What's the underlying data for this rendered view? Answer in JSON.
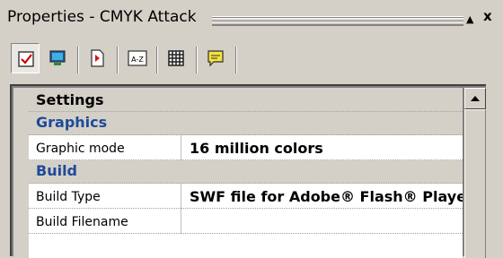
{
  "window": {
    "title": "Properties - CMYK Attack",
    "pin_glyph": "▲",
    "close_glyph": "x"
  },
  "toolbar": {
    "buttons": [
      {
        "name": "properties-icon",
        "active": true
      },
      {
        "name": "display-icon",
        "active": false
      },
      {
        "name": "events-icon",
        "active": false
      },
      {
        "name": "alphabetical-icon",
        "active": false
      },
      {
        "name": "categorized-icon",
        "active": false
      },
      {
        "name": "description-icon",
        "active": false
      }
    ]
  },
  "grid": {
    "section_header": "Settings",
    "categories": {
      "graphics": "Graphics",
      "build": "Build"
    },
    "rows": {
      "graphic_mode": {
        "name": "Graphic mode",
        "value": "16 million colors"
      },
      "build_type": {
        "name": "Build Type",
        "value": "SWF file for Adobe® Flash® Player"
      },
      "build_filename": {
        "name": "Build Filename",
        "value": ""
      }
    }
  },
  "colors": {
    "panel_bg": "#d4d0c8",
    "category_text": "#1e4a9a"
  }
}
